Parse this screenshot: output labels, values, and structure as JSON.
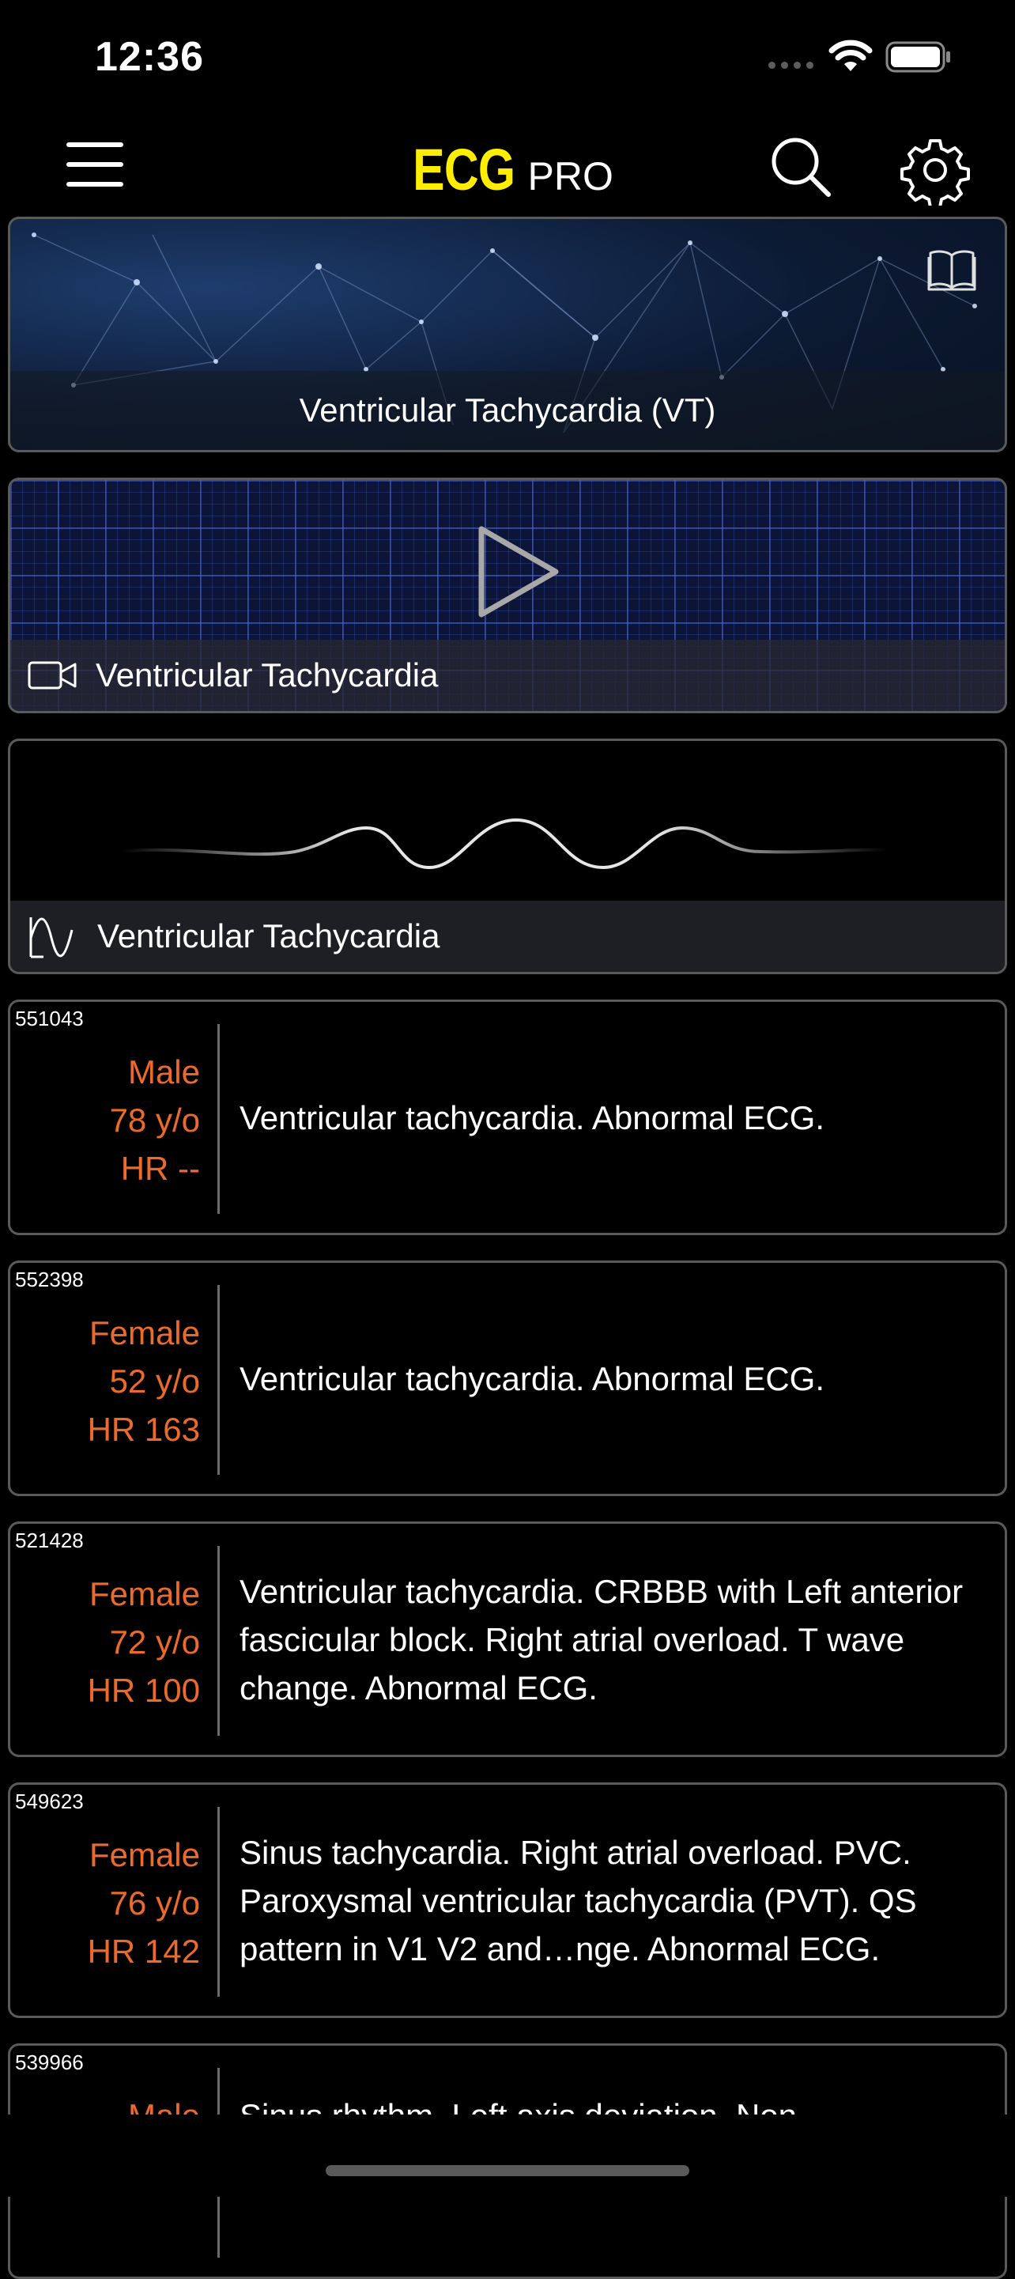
{
  "status_bar": {
    "time": "12:36",
    "icons": [
      "cellular-icon",
      "wifi-icon",
      "battery-icon"
    ]
  },
  "nav": {
    "title_main": "ECG",
    "title_sub": "PRO",
    "icons": [
      "menu-icon",
      "search-icon",
      "gear-icon"
    ]
  },
  "colors": {
    "brand": "#ffee00",
    "meta": "#ec6a2a",
    "border": "#5a5a5a"
  },
  "hero": {
    "title": "Ventricular Tachycardia (VT)",
    "icon": "book-icon"
  },
  "video": {
    "title": "Ventricular Tachycardia",
    "icons": [
      "play-icon",
      "video-camera-icon"
    ]
  },
  "waveform": {
    "title": "Ventricular Tachycardia",
    "icon": "waveform-icon"
  },
  "entries": [
    {
      "id": "551043",
      "sex": "Male",
      "age": "78 y/o",
      "hr": "HR --",
      "desc": "Ventricular tachycardia. Abnormal ECG."
    },
    {
      "id": "552398",
      "sex": "Female",
      "age": "52 y/o",
      "hr": "HR 163",
      "desc": "Ventricular tachycardia. Abnormal ECG."
    },
    {
      "id": "521428",
      "sex": "Female",
      "age": "72 y/o",
      "hr": "HR 100",
      "desc": "Ventricular tachycardia. CRBBB with Left anterior fascicular block. Right atrial overload. T wave change. Abnormal ECG."
    },
    {
      "id": "549623",
      "sex": "Female",
      "age": "76 y/o",
      "hr": "HR 142",
      "desc": "Sinus tachycardia. Right atrial overload. PVC. Paroxysmal ventricular tachycardia (PVT). QS pattern in V1 V2 and…nge. Abnormal ECG."
    },
    {
      "id": "539966",
      "sex": "Male",
      "age": "",
      "hr": "",
      "desc": "Sinus rhythm. Left axis deviation. Non"
    }
  ]
}
